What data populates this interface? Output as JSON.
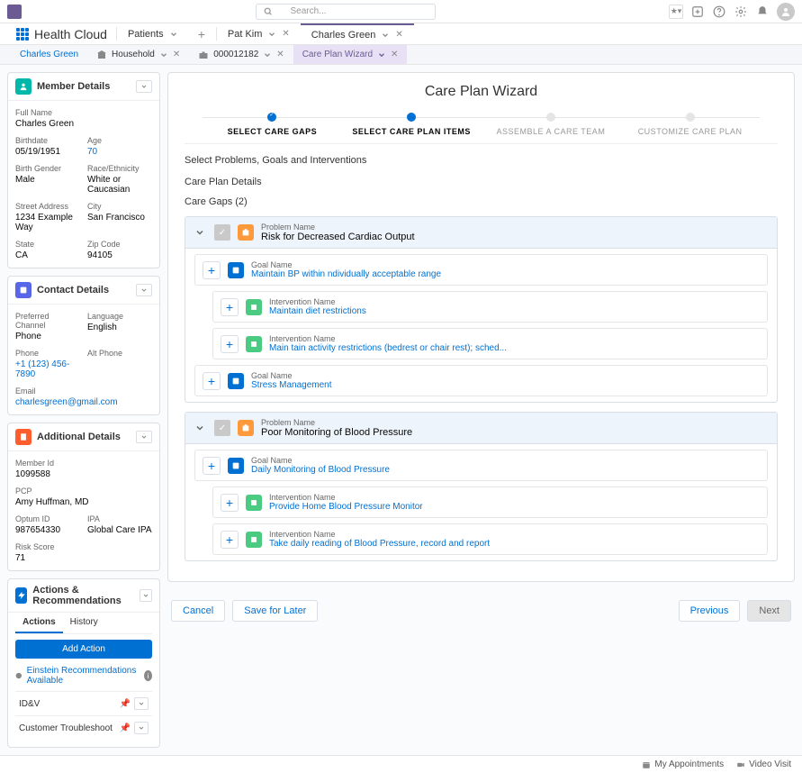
{
  "topbar": {
    "search_placeholder": "Search..."
  },
  "nav": {
    "app_name": "Health Cloud",
    "tabs": [
      {
        "label": "Patients"
      },
      {
        "label": "Pat Kim"
      },
      {
        "label": "Charles Green"
      }
    ]
  },
  "subnav": {
    "items": [
      {
        "label": "Charles Green"
      },
      {
        "label": "Household"
      },
      {
        "label": "000012182"
      },
      {
        "label": "Care Plan Wizard"
      }
    ]
  },
  "panels": {
    "member": {
      "title": "Member Details",
      "full_name_label": "Full Name",
      "full_name": "Charles Green",
      "birthdate_label": "Birthdate",
      "birthdate": "05/19/1951",
      "age_label": "Age",
      "age": "70",
      "birth_gender_label": "Birth Gender",
      "birth_gender": "Male",
      "race_label": "Race/Ethnicity",
      "race": "White or Caucasian",
      "street_label": "Street Address",
      "street": "1234 Example Way",
      "city_label": "City",
      "city": "San Francisco",
      "state_label": "State",
      "state": "CA",
      "zip_label": "Zip Code",
      "zip": "94105"
    },
    "contact": {
      "title": "Contact Details",
      "pref_channel_label": "Preferred Channel",
      "pref_channel": "Phone",
      "language_label": "Language",
      "language": "English",
      "phone_label": "Phone",
      "phone": "+1 (123) 456-7890",
      "alt_phone_label": "Alt Phone",
      "alt_phone": "",
      "email_label": "Email",
      "email": "charlesgreen@gmail.com"
    },
    "additional": {
      "title": "Additional Details",
      "member_id_label": "Member Id",
      "member_id": "1099588",
      "pcp_label": "PCP",
      "pcp": "Amy Huffman, MD",
      "optum_label": "Optum ID",
      "optum": "987654330",
      "ipa_label": "IPA",
      "ipa": "Global Care IPA",
      "risk_label": "Risk Score",
      "risk": "71"
    },
    "actions": {
      "title": "Actions & Recommendations",
      "tab_actions": "Actions",
      "tab_history": "History",
      "add_btn": "Add Action",
      "einstein": "Einstein Recommendations Available",
      "item1": "ID&V",
      "item2": "Customer Troubleshoot"
    }
  },
  "wizard": {
    "title": "Care Plan Wizard",
    "steps": [
      "SELECT  CARE GAPS",
      "SELECT CARE PLAN ITEMS",
      "ASSEMBLE A CARE TEAM",
      "CUSTOMIZE CARE PLAN"
    ],
    "section_head": "Select Problems, Goals and Interventions",
    "details_head": "Care Plan Details",
    "gaps_head": "Care Gaps (2)",
    "problem_label": "Problem Name",
    "goal_label": "Goal Name",
    "interv_label": "Intervention Name",
    "problems": [
      {
        "name": "Risk for Decreased Cardiac Output",
        "goals": [
          {
            "name": "Maintain BP within ndividually acceptable range",
            "interventions": [
              "Maintain diet restrictions",
              "Main tain activity restrictions (bedrest or chair rest); sched..."
            ]
          },
          {
            "name": "Stress Management",
            "interventions": []
          }
        ]
      },
      {
        "name": "Poor Monitoring of Blood Pressure",
        "goals": [
          {
            "name": "Daily Monitoring of Blood Pressure",
            "interventions": [
              "Provide Home Blood Pressure Monitor",
              "Take daily reading of Blood Pressure, record and report"
            ]
          }
        ]
      }
    ],
    "buttons": {
      "cancel": "Cancel",
      "save": "Save for Later",
      "prev": "Previous",
      "next": "Next"
    }
  },
  "bottombar": {
    "appt": "My Appointments",
    "video": "Video Visit"
  }
}
